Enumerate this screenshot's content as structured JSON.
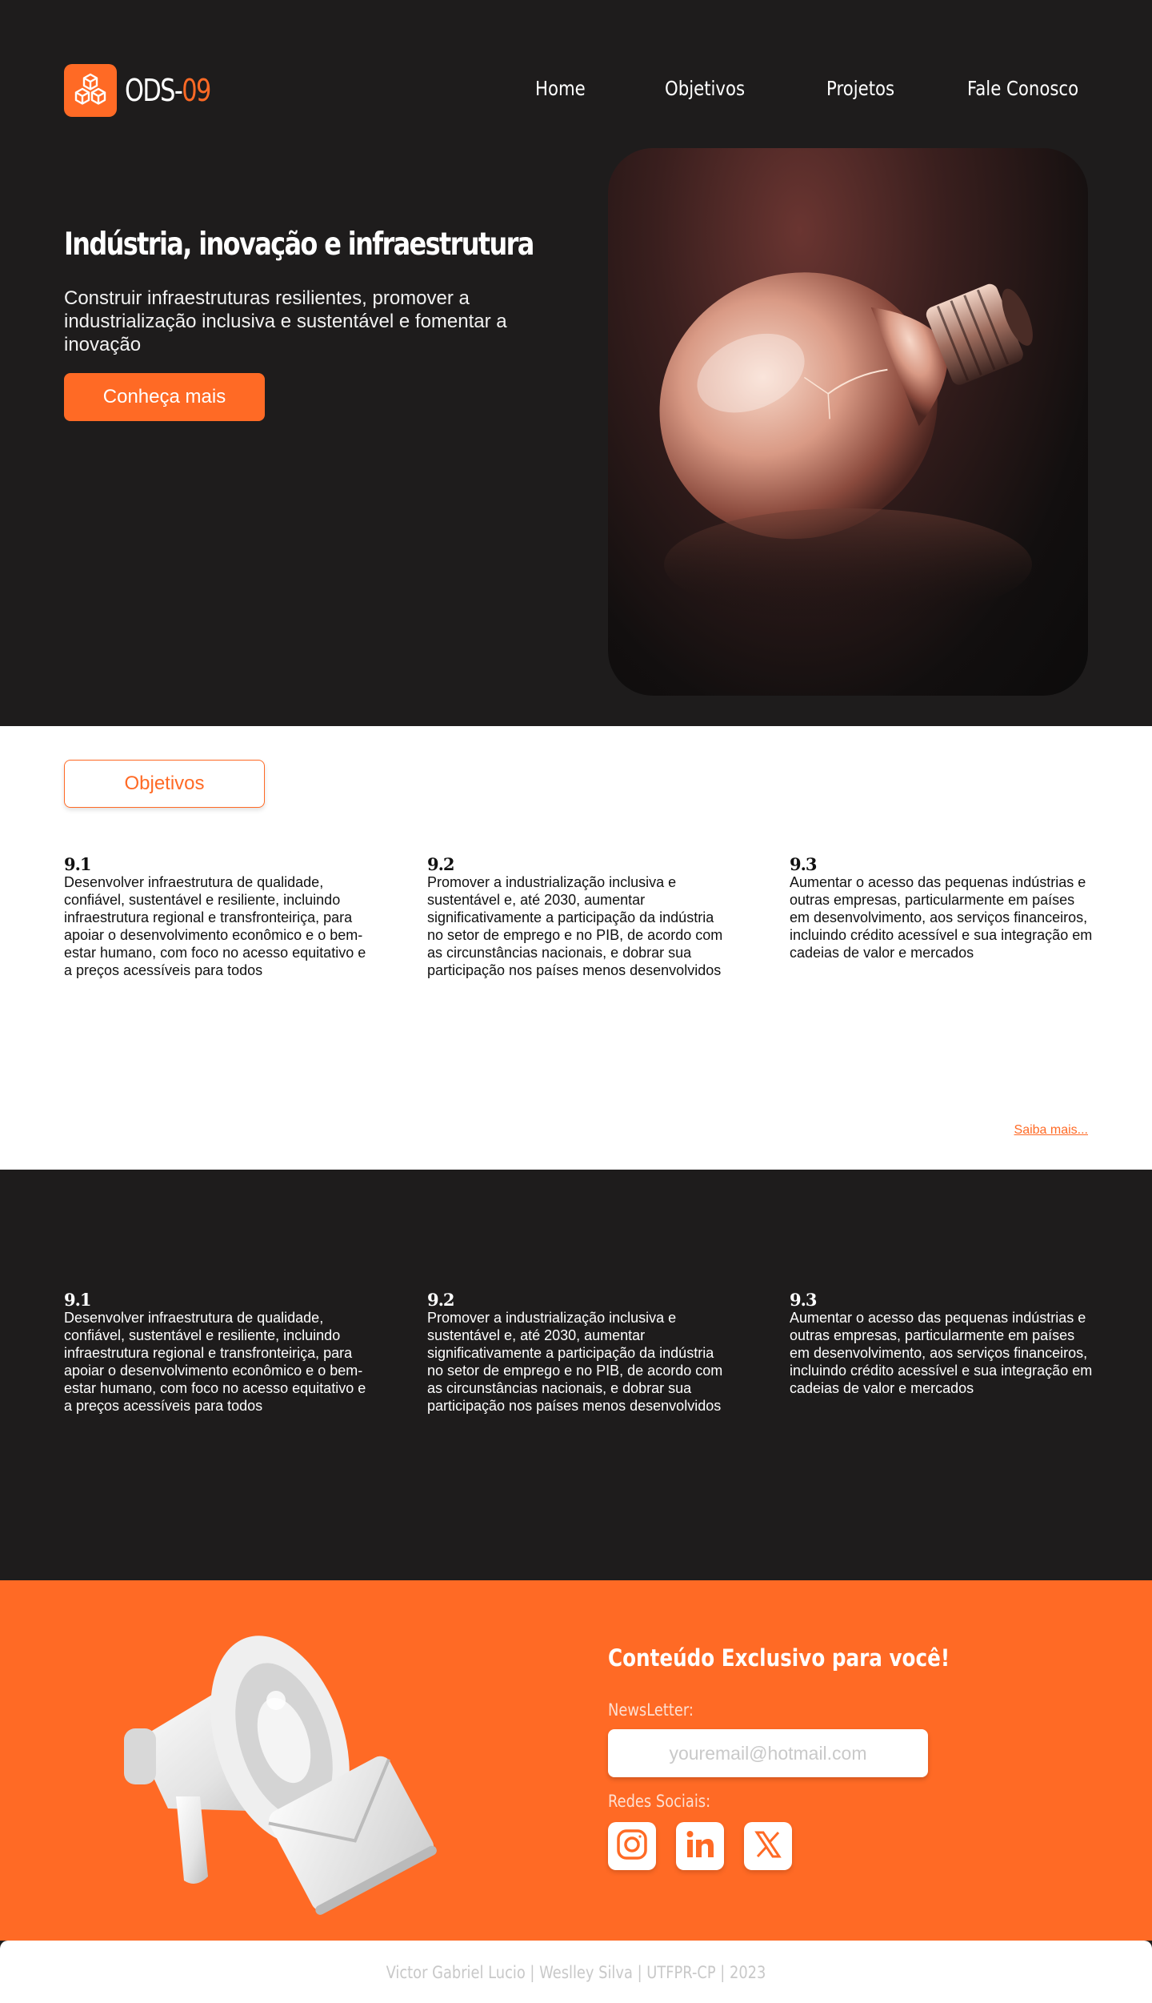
{
  "brand": {
    "name": "ODS-",
    "number": "09"
  },
  "nav": [
    {
      "label": "Home"
    },
    {
      "label": "Objetivos"
    },
    {
      "label": "Projetos"
    },
    {
      "label": "Fale Conosco"
    }
  ],
  "hero": {
    "title": "Indústria, inovação e infraestrutura",
    "subtitle": "Construir infraestruturas resilientes, promover a industrialização inclusiva e sustentável e fomentar a inovação",
    "cta": "Conheça mais"
  },
  "objectives": {
    "button": "Objetivos",
    "more_link": "Saiba mais...",
    "goals": [
      {
        "num": "9.1",
        "text": "Desenvolver infraestrutura de qualidade, confiável, sustentável e resiliente, incluindo infraestrutura regional e transfronteiriça, para apoiar o desenvolvimento econômico e o bem-estar humano, com foco no acesso equitativo e a preços acessíveis para todos"
      },
      {
        "num": "9.2",
        "text": "Promover a industrialização inclusiva e sustentável e, até 2030, aumentar significativamente a participação da indústria no setor de emprego e no PIB, de acordo com as circunstâncias nacionais, e dobrar sua participação nos países menos desenvolvidos"
      },
      {
        "num": "9.3",
        "text": "Aumentar o acesso das pequenas indústrias e outras empresas, particularmente em países em desenvolvimento, aos serviços financeiros, incluindo crédito acessível e sua integração em cadeias de valor e mercados"
      }
    ]
  },
  "newsletter": {
    "title": "Conteúdo Exclusivo para você!",
    "label": "NewsLetter:",
    "placeholder": "youremail@hotmail.com",
    "social_label": "Redes Sociais:",
    "social": [
      {
        "icon": "instagram-icon"
      },
      {
        "icon": "linkedin-icon"
      },
      {
        "icon": "x-icon"
      }
    ]
  },
  "footer": {
    "text": "Victor Gabriel Lucio | Weslley Silva | UTFPR-CP | 2023"
  },
  "colors": {
    "accent": "#ff6a25",
    "dark": "#1e1c1c",
    "light": "#ffffff"
  }
}
